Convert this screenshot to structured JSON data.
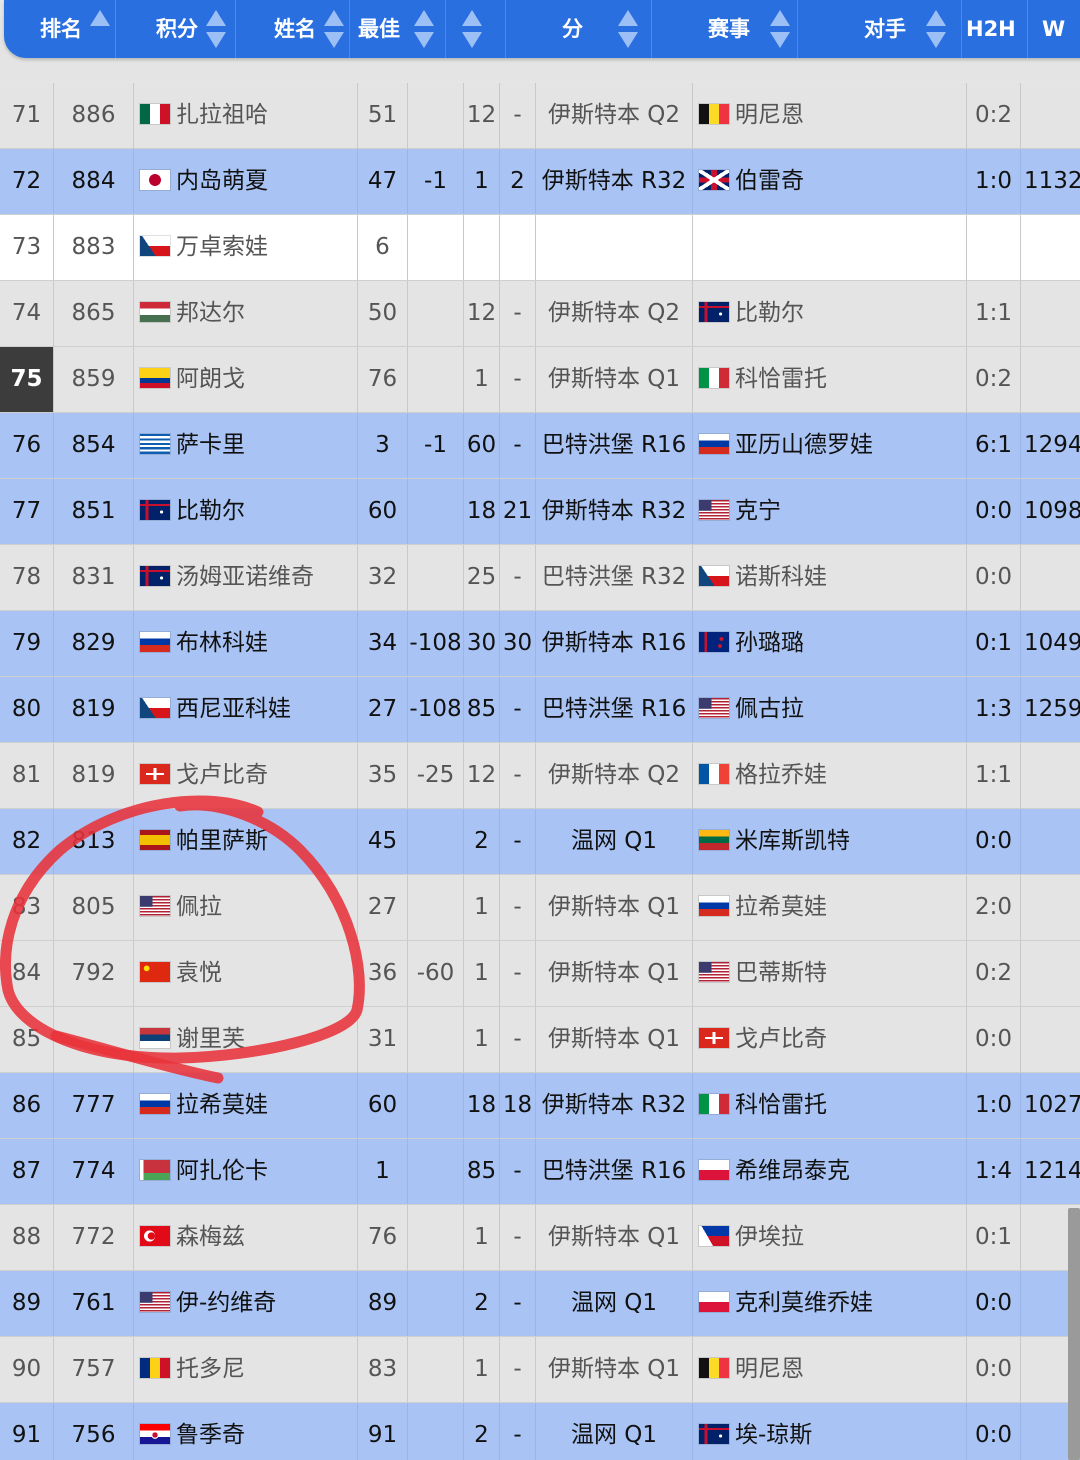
{
  "header": {
    "rank": "排名",
    "points": "积分",
    "name": "姓名",
    "best": "最佳",
    "change": "",
    "s1": "",
    "pts_col": "分",
    "event": "赛事",
    "opponent": "对手",
    "h2h": "H2H",
    "w": "W"
  },
  "rows": [
    {
      "rank": "71",
      "points": "886",
      "flag": "mx",
      "name": "扎拉祖哈",
      "best": "51",
      "chg": "",
      "s1": "12",
      "s2": "-",
      "event": "伊斯特本 Q2",
      "oppflag": "be",
      "opp": "明尼恩",
      "h2h": "0:2",
      "w": "",
      "style": "gray"
    },
    {
      "rank": "72",
      "points": "884",
      "flag": "jp",
      "name": "内岛萌夏",
      "best": "47",
      "chg": "-1",
      "s1": "1",
      "s2": "2",
      "event": "伊斯特本 R32",
      "oppflag": "gb",
      "opp": "伯雷奇",
      "h2h": "1:0",
      "w": "1132",
      "style": "blue"
    },
    {
      "rank": "73",
      "points": "883",
      "flag": "cz",
      "name": "万卓索娃",
      "best": "6",
      "chg": "",
      "s1": "",
      "s2": "",
      "event": "",
      "oppflag": "",
      "opp": "",
      "h2h": "",
      "w": "",
      "style": "white"
    },
    {
      "rank": "74",
      "points": "865",
      "flag": "hu",
      "name": "邦达尔",
      "best": "50",
      "chg": "",
      "s1": "12",
      "s2": "-",
      "event": "伊斯特本 Q2",
      "oppflag": "au",
      "opp": "比勒尔",
      "h2h": "1:1",
      "w": "",
      "style": "gray"
    },
    {
      "rank": "75",
      "points": "859",
      "flag": "co",
      "name": "阿朗戈",
      "best": "76",
      "chg": "",
      "s1": "1",
      "s2": "-",
      "event": "伊斯特本 Q1",
      "oppflag": "it",
      "opp": "科恰雷托",
      "h2h": "0:2",
      "w": "",
      "style": "gray",
      "highlight": true
    },
    {
      "rank": "76",
      "points": "854",
      "flag": "gr",
      "name": "萨卡里",
      "best": "3",
      "chg": "-1",
      "s1": "60",
      "s2": "-",
      "event": "巴特洪堡 R16",
      "oppflag": "ru",
      "opp": "亚历山德罗娃",
      "h2h": "6:1",
      "w": "1294",
      "style": "blue"
    },
    {
      "rank": "77",
      "points": "851",
      "flag": "au",
      "name": "比勒尔",
      "best": "60",
      "chg": "",
      "s1": "18",
      "s2": "21",
      "event": "伊斯特本 R32",
      "oppflag": "us",
      "opp": "克宁",
      "h2h": "0:0",
      "w": "1098",
      "style": "blue"
    },
    {
      "rank": "78",
      "points": "831",
      "flag": "au",
      "name": "汤姆亚诺维奇",
      "best": "32",
      "chg": "",
      "s1": "25",
      "s2": "-",
      "event": "巴特洪堡 R32",
      "oppflag": "cz",
      "opp": "诺斯科娃",
      "h2h": "0:0",
      "w": "",
      "style": "gray"
    },
    {
      "rank": "79",
      "points": "829",
      "flag": "ru",
      "name": "布林科娃",
      "best": "34",
      "chg": "-108",
      "s1": "30",
      "s2": "30",
      "event": "伊斯特本 R16",
      "oppflag": "nz",
      "opp": "孙璐璐",
      "h2h": "0:1",
      "w": "1049",
      "style": "blue"
    },
    {
      "rank": "80",
      "points": "819",
      "flag": "cz",
      "name": "西尼亚科娃",
      "best": "27",
      "chg": "-108",
      "s1": "85",
      "s2": "-",
      "event": "巴特洪堡 R16",
      "oppflag": "us",
      "opp": "佩古拉",
      "h2h": "1:3",
      "w": "1259",
      "style": "blue"
    },
    {
      "rank": "81",
      "points": "819",
      "flag": "ch",
      "name": "戈卢比奇",
      "best": "35",
      "chg": "-25",
      "s1": "12",
      "s2": "-",
      "event": "伊斯特本 Q2",
      "oppflag": "fr",
      "opp": "格拉乔娃",
      "h2h": "1:1",
      "w": "",
      "style": "gray"
    },
    {
      "rank": "82",
      "points": "813",
      "flag": "es",
      "name": "帕里萨斯",
      "best": "45",
      "chg": "",
      "s1": "2",
      "s2": "-",
      "event": "温网 Q1",
      "oppflag": "lt",
      "opp": "米库斯凯特",
      "h2h": "0:0",
      "w": "",
      "style": "blue"
    },
    {
      "rank": "83",
      "points": "805",
      "flag": "us",
      "name": "佩拉",
      "best": "27",
      "chg": "",
      "s1": "1",
      "s2": "-",
      "event": "伊斯特本 Q1",
      "oppflag": "ru",
      "opp": "拉希莫娃",
      "h2h": "2:0",
      "w": "",
      "style": "gray"
    },
    {
      "rank": "84",
      "points": "792",
      "flag": "cn",
      "name": "袁悦",
      "best": "36",
      "chg": "-60",
      "s1": "1",
      "s2": "-",
      "event": "伊斯特本 Q1",
      "oppflag": "us",
      "opp": "巴蒂斯特",
      "h2h": "0:2",
      "w": "",
      "style": "gray"
    },
    {
      "rank": "85",
      "points": "",
      "flag": "rs",
      "name": "谢里芙",
      "best": "31",
      "chg": "",
      "s1": "1",
      "s2": "-",
      "event": "伊斯特本 Q1",
      "oppflag": "ch",
      "opp": "戈卢比奇",
      "h2h": "0:0",
      "w": "",
      "style": "gray"
    },
    {
      "rank": "86",
      "points": "777",
      "flag": "ru",
      "name": "拉希莫娃",
      "best": "60",
      "chg": "",
      "s1": "18",
      "s2": "18",
      "event": "伊斯特本 R32",
      "oppflag": "it",
      "opp": "科恰雷托",
      "h2h": "1:0",
      "w": "1027",
      "style": "blue"
    },
    {
      "rank": "87",
      "points": "774",
      "flag": "by",
      "name": "阿扎伦卡",
      "best": "1",
      "chg": "",
      "s1": "85",
      "s2": "-",
      "event": "巴特洪堡 R16",
      "oppflag": "pl",
      "opp": "希维昂泰克",
      "h2h": "1:4",
      "w": "1214",
      "style": "blue"
    },
    {
      "rank": "88",
      "points": "772",
      "flag": "tr",
      "name": "森梅兹",
      "best": "76",
      "chg": "",
      "s1": "1",
      "s2": "-",
      "event": "伊斯特本 Q1",
      "oppflag": "ph",
      "opp": "伊埃拉",
      "h2h": "0:1",
      "w": "",
      "style": "gray"
    },
    {
      "rank": "89",
      "points": "761",
      "flag": "us",
      "name": "伊-约维奇",
      "best": "89",
      "chg": "",
      "s1": "2",
      "s2": "-",
      "event": "温网 Q1",
      "oppflag": "pl",
      "opp": "克利莫维乔娃",
      "h2h": "0:0",
      "w": "",
      "style": "blue"
    },
    {
      "rank": "90",
      "points": "757",
      "flag": "ro",
      "name": "托多尼",
      "best": "83",
      "chg": "",
      "s1": "1",
      "s2": "-",
      "event": "伊斯特本 Q1",
      "oppflag": "be",
      "opp": "明尼恩",
      "h2h": "0:0",
      "w": "",
      "style": "gray"
    },
    {
      "rank": "91",
      "points": "756",
      "flag": "hr",
      "name": "鲁季奇",
      "best": "91",
      "chg": "",
      "s1": "2",
      "s2": "-",
      "event": "温网 Q1",
      "oppflag": "au",
      "opp": "埃-琼斯",
      "h2h": "0:0",
      "w": "",
      "style": "blue"
    }
  ],
  "colors": {
    "header_bg": "#2a6fe0",
    "row_blue": "#a9c4f4",
    "row_gray": "#e4e4e4",
    "annotation": "#e8323a"
  }
}
